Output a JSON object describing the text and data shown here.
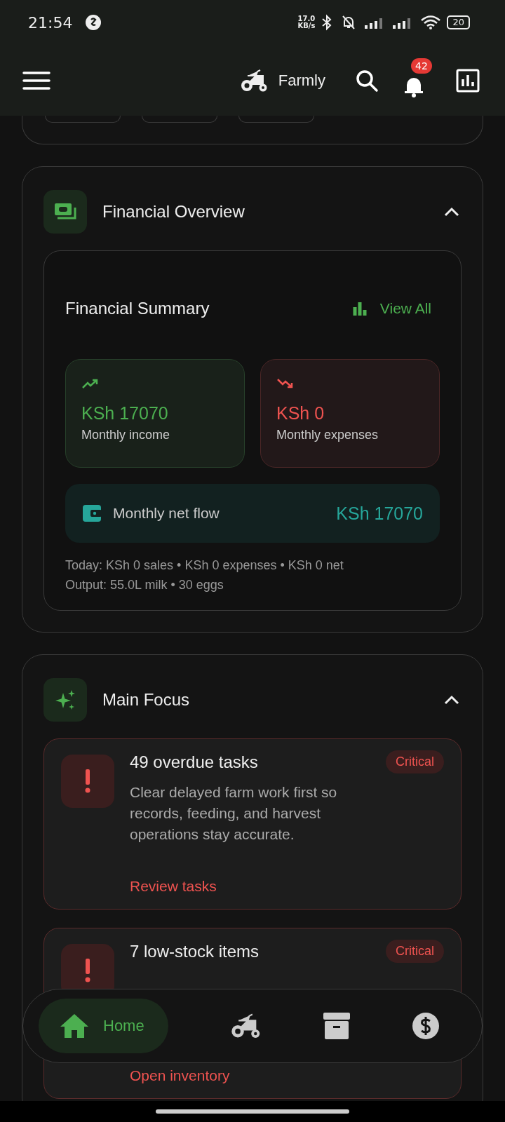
{
  "status_bar": {
    "time": "21:54",
    "net_speed": [
      "17.0",
      "KB/s"
    ],
    "battery": "20"
  },
  "app_bar": {
    "title": "Farmly",
    "notification_count": "42"
  },
  "financial_overview": {
    "title": "Financial Overview",
    "expanded": true,
    "summary": {
      "title": "Financial Summary",
      "view_all": "View All",
      "stats": [
        {
          "kind": "income",
          "amount": "KSh 17070",
          "label": "Monthly income"
        },
        {
          "kind": "expense",
          "amount": "KSh 0",
          "label": "Monthly expenses"
        }
      ],
      "net_flow": {
        "label": "Monthly net flow",
        "amount": "KSh 17070"
      },
      "today": "Today: KSh 0 sales • KSh 0 expenses • KSh 0 net",
      "output": "Output: 55.0L milk • 30 eggs"
    }
  },
  "main_focus": {
    "title": "Main Focus",
    "expanded": true,
    "items": [
      {
        "title": "49 overdue tasks",
        "badge": "Critical",
        "description": "Clear delayed farm work first so records, feeding, and harvest operations stay accurate.",
        "action": "Review tasks"
      },
      {
        "title": "7 low-stock items",
        "badge": "Critical",
        "action": "Open inventory"
      }
    ]
  },
  "bottom_nav": [
    {
      "kind": "home",
      "label": "Home",
      "selected": true
    },
    {
      "kind": "farm",
      "selected": false
    },
    {
      "kind": "inventory",
      "selected": false
    },
    {
      "kind": "finance",
      "selected": false
    }
  ]
}
